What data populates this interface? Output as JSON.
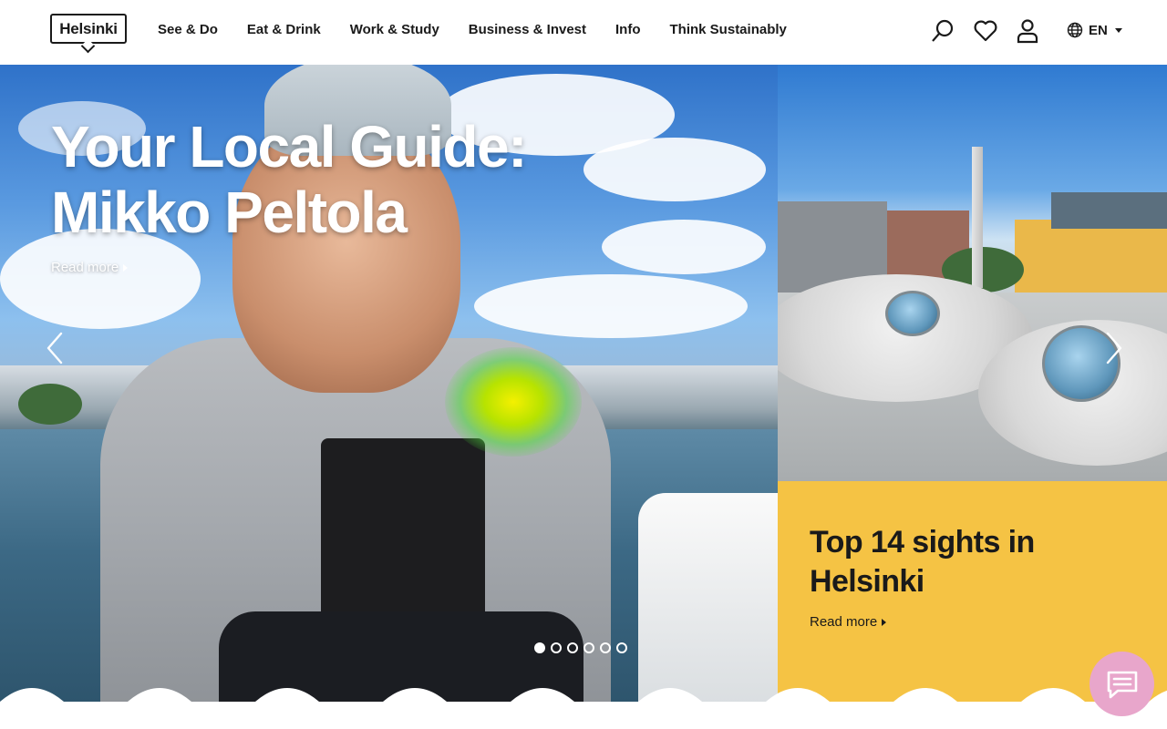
{
  "header": {
    "logo_text": "Helsinki",
    "nav": [
      "See & Do",
      "Eat & Drink",
      "Work & Study",
      "Business & Invest",
      "Info",
      "Think Sustainably"
    ],
    "language": "EN"
  },
  "hero": {
    "title": "Your Local Guide: Mikko Peltola",
    "read_more": "Read more",
    "slides_total": 6,
    "active_slide": 1
  },
  "card": {
    "title": "Top 14 sights in Helsinki",
    "read_more": "Read more",
    "background_color": "#f5c344"
  },
  "icons": {
    "search": "search-icon",
    "favorites": "heart-icon",
    "account": "user-icon",
    "language": "globe-icon",
    "prev": "chevron-left-icon",
    "next": "chevron-right-icon",
    "chat": "chat-icon"
  },
  "colors": {
    "chat_bubble": "#e8a6cb",
    "text": "#1a1a1a"
  }
}
